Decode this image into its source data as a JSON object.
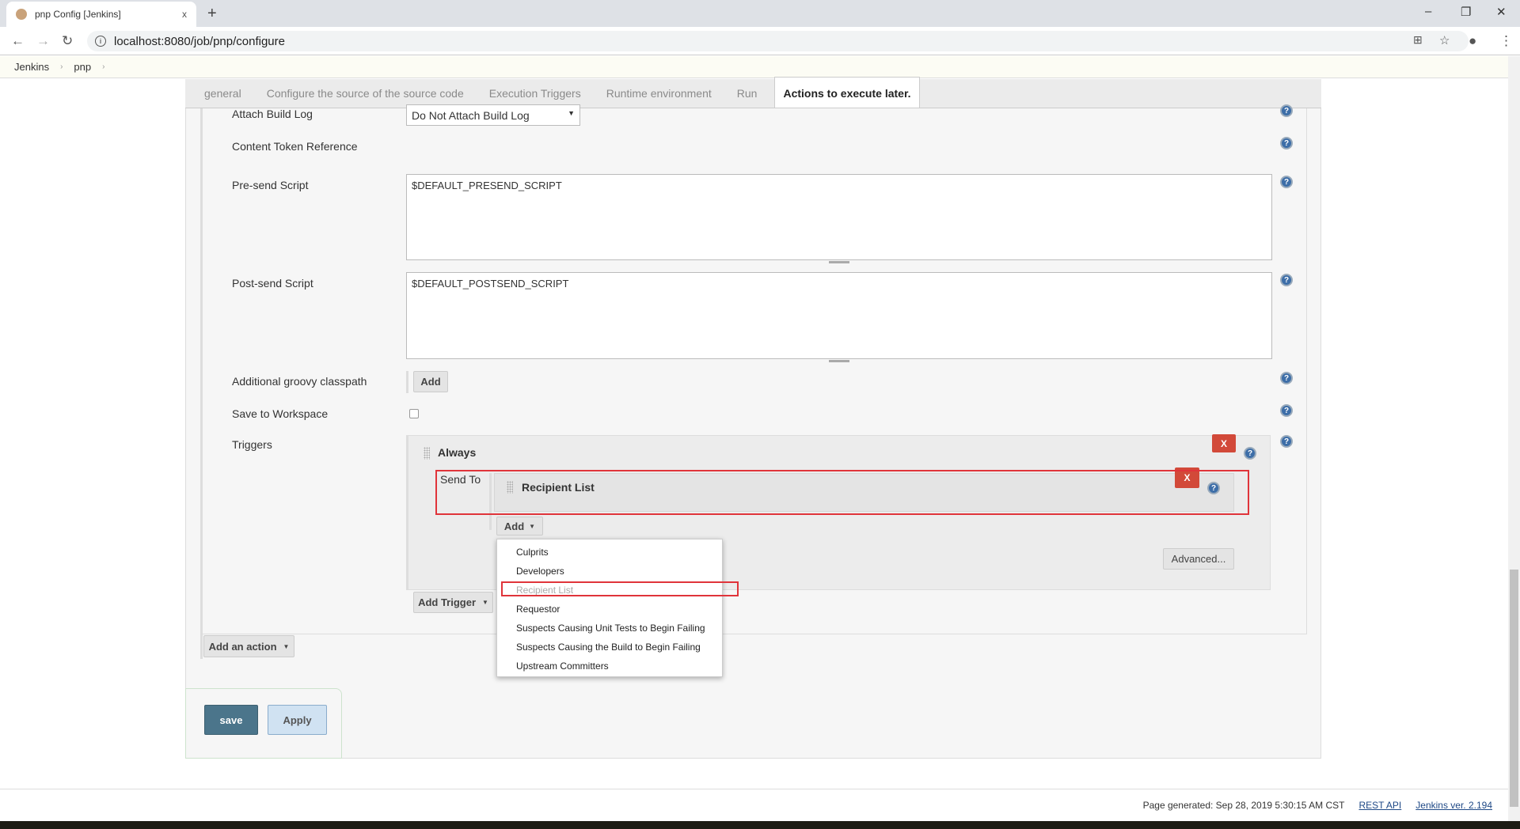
{
  "browser": {
    "tab_title": "pnp Config [Jenkins]",
    "tab_close": "x",
    "new_tab": "+",
    "url": "localhost:8080/job/pnp/configure",
    "minimize": "–",
    "restore": "❐",
    "close": "✕"
  },
  "breadcrumbs": [
    "Jenkins",
    "pnp"
  ],
  "config_tabs": [
    "general",
    "Configure the source of the source code",
    "Execution Triggers",
    "Runtime environment",
    "Run",
    "Actions to execute later."
  ],
  "active_tab": "Actions to execute later.",
  "form": {
    "attach_build_log": {
      "label": "Attach Build Log",
      "value": "Do Not Attach Build Log"
    },
    "content_token_reference": {
      "label": "Content Token Reference"
    },
    "presend_script": {
      "label": "Pre-send Script",
      "value": "$DEFAULT_PRESEND_SCRIPT"
    },
    "postsend_script": {
      "label": "Post-send Script",
      "value": "$DEFAULT_POSTSEND_SCRIPT"
    },
    "groovy_classpath": {
      "label": "Additional groovy classpath",
      "add_label": "Add"
    },
    "save_to_workspace": {
      "label": "Save to Workspace",
      "checked": false
    },
    "triggers": {
      "label": "Triggers",
      "trigger_name": "Always",
      "send_to_label": "Send To",
      "recipient": "Recipient List",
      "delete_label": "X",
      "add_label": "Add",
      "advanced_label": "Advanced...",
      "add_trigger_label": "Add Trigger"
    }
  },
  "add_menu": {
    "items": [
      "Culprits",
      "Developers",
      "Recipient List",
      "Requestor",
      "Suspects Causing Unit Tests to Begin Failing",
      "Suspects Causing the Build to Begin Failing",
      "Upstream Committers"
    ],
    "disabled": "Recipient List"
  },
  "add_action_label": "Add an action",
  "buttons": {
    "save": "save",
    "apply": "Apply"
  },
  "footer": {
    "generated": "Page generated: Sep 28, 2019 5:30:15 AM CST",
    "rest_api": "REST API",
    "version": "Jenkins ver. 2.194"
  },
  "colors": {
    "save_button": "#4b758b",
    "delete_button": "#d24939",
    "highlight": "#e0343a"
  }
}
